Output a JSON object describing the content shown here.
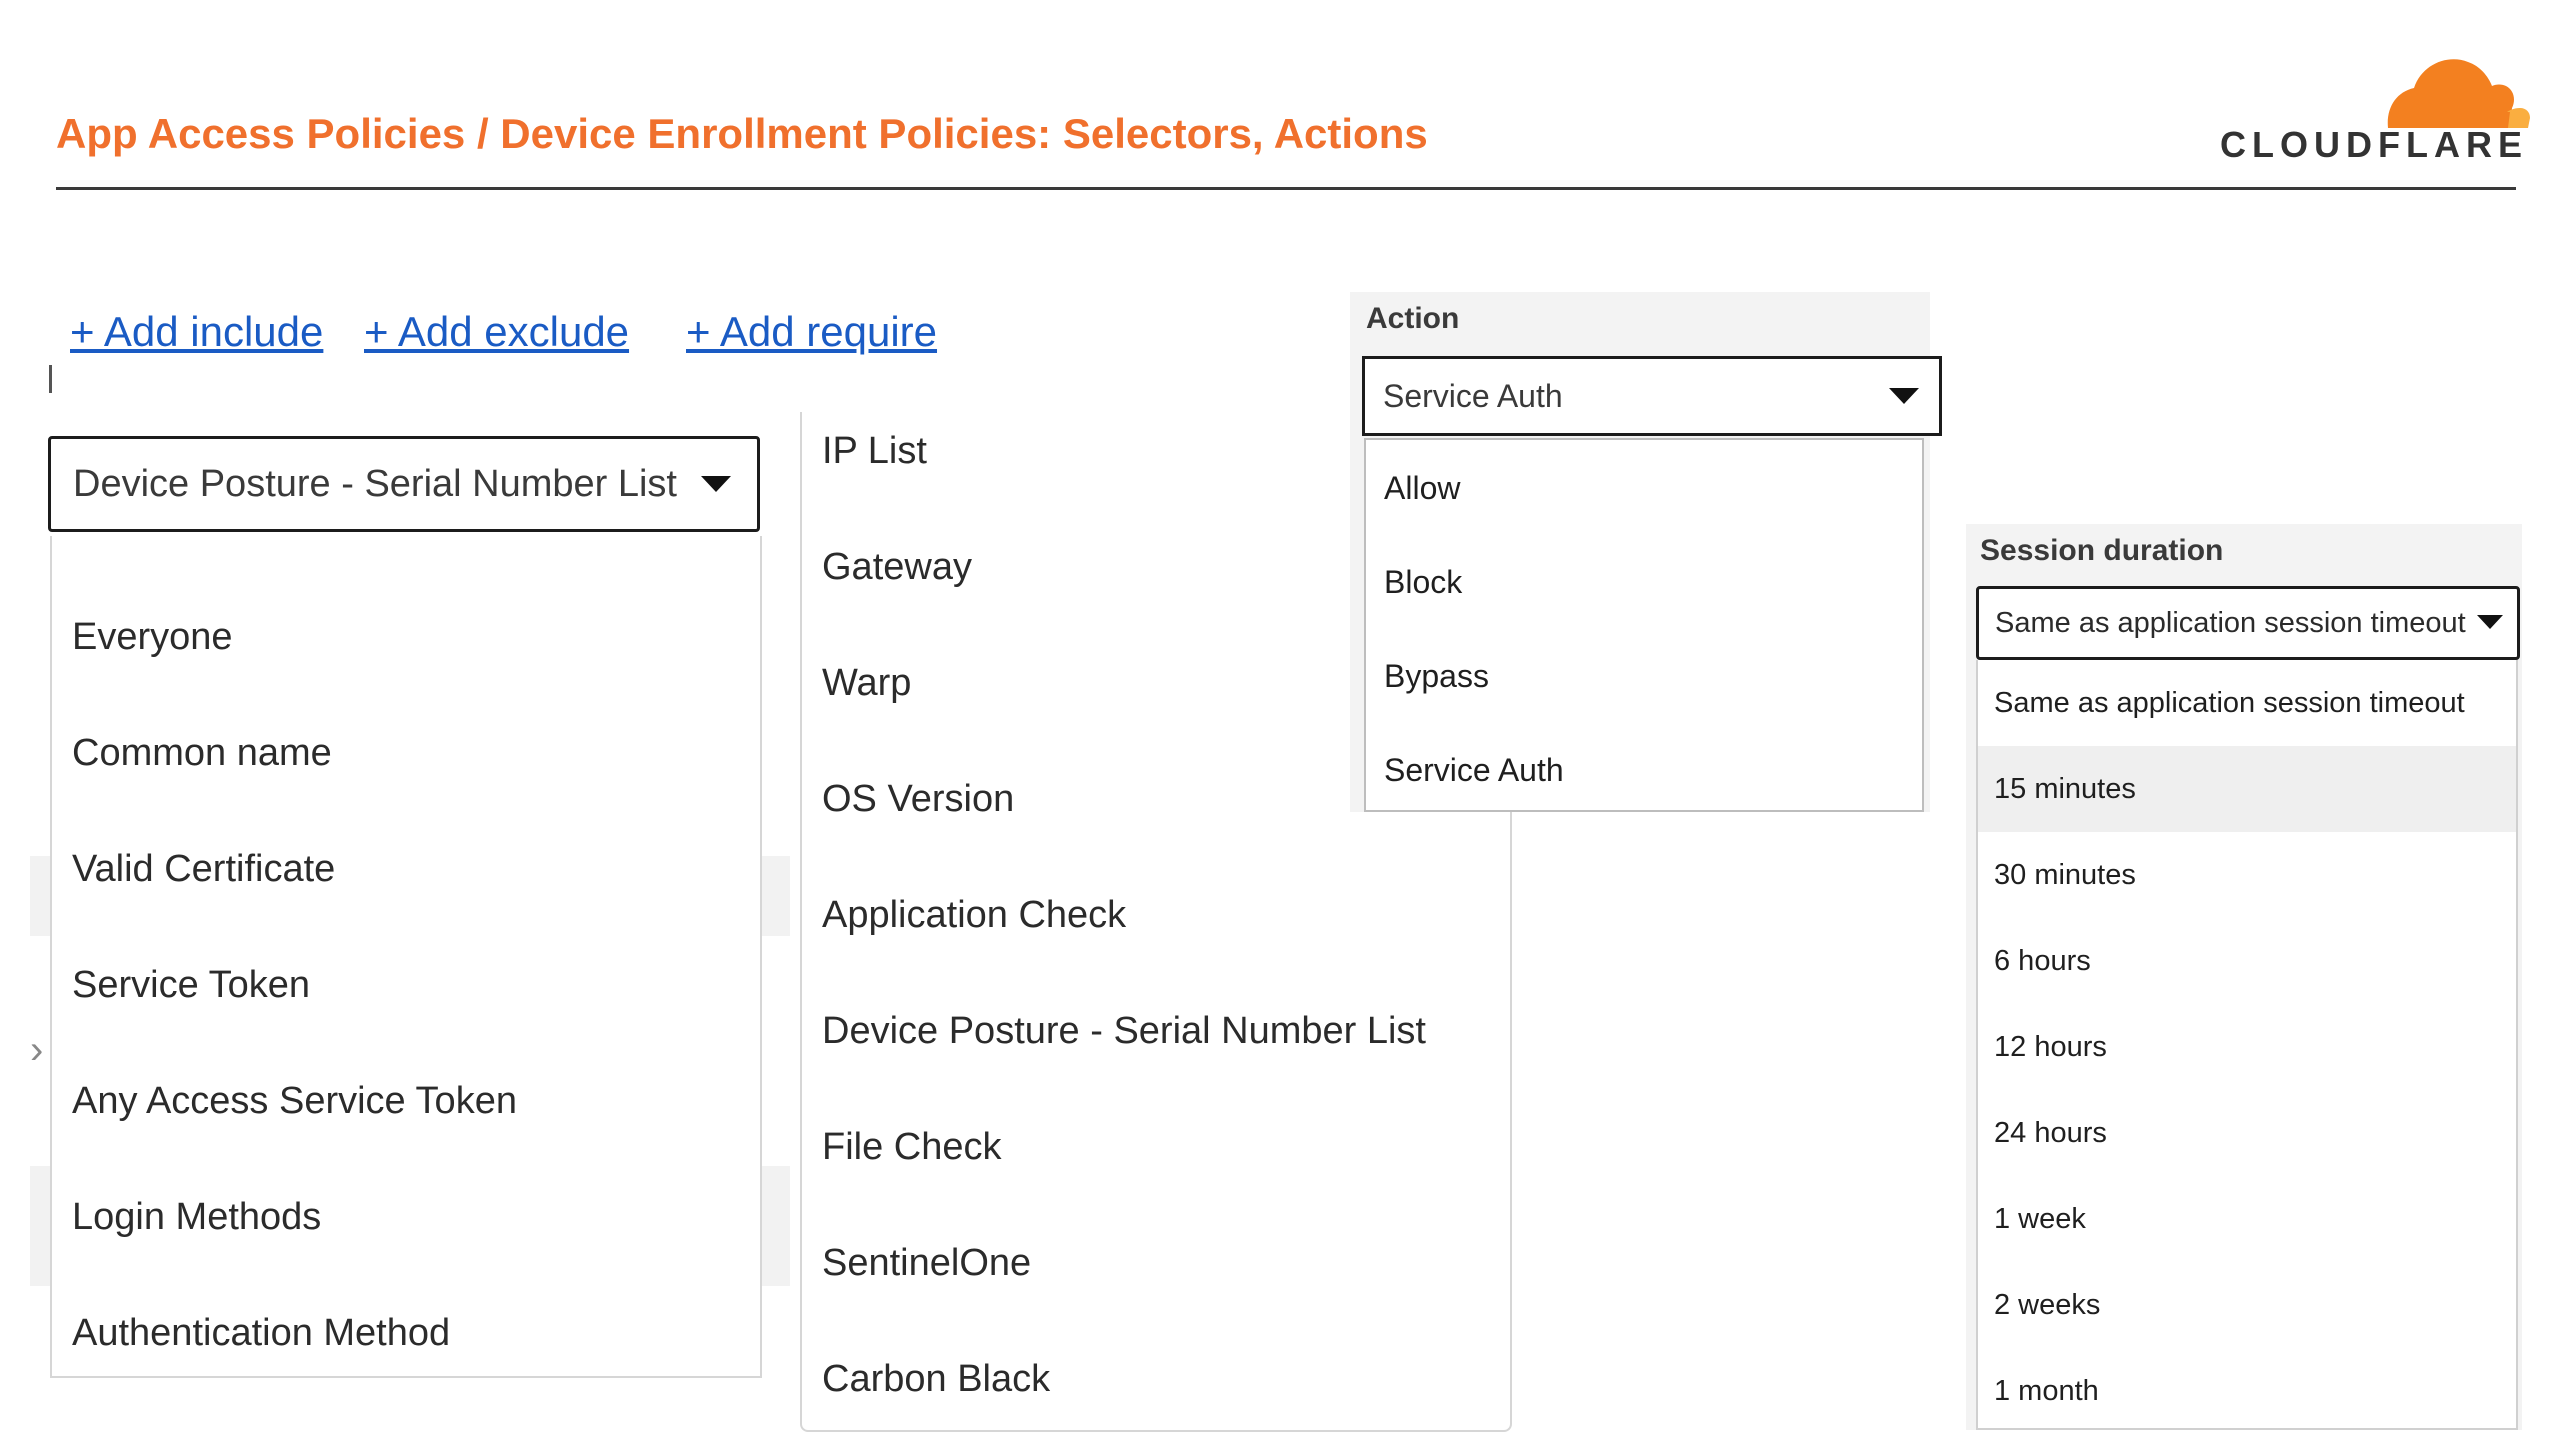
{
  "header": {
    "title": "App Access Policies / Device Enrollment Policies: Selectors, Actions",
    "brand": "CLOUDFLARE",
    "brand_colors": {
      "title": "#f0702d",
      "cloud_main": "#f38020",
      "cloud_light": "#faae40"
    }
  },
  "rule_links": {
    "add_include": "+ Add include",
    "add_exclude": "+ Add exclude",
    "add_require": "+ Add require"
  },
  "selector_dropdown": {
    "selected": "Device Posture - Serial Number List",
    "options_column1": [
      "Everyone",
      "Common name",
      "Valid Certificate",
      "Service Token",
      "Any Access Service Token",
      "Login Methods",
      "Authentication Method"
    ],
    "options_column2": [
      "IP List",
      "Gateway",
      "Warp",
      "OS Version",
      "Application Check",
      "Device Posture - Serial Number List",
      "File Check",
      "SentinelOne",
      "Carbon Black"
    ]
  },
  "action": {
    "label": "Action",
    "selected": "Service Auth",
    "options": [
      "Allow",
      "Block",
      "Bypass",
      "Service Auth"
    ]
  },
  "session_duration": {
    "label": "Session duration",
    "selected": "Same as application session timeout",
    "highlighted_index": 1,
    "options": [
      "Same as application session timeout",
      "15 minutes",
      "30 minutes",
      "6 hours",
      "12 hours",
      "24 hours",
      "1 week",
      "2 weeks",
      "1 month"
    ]
  }
}
